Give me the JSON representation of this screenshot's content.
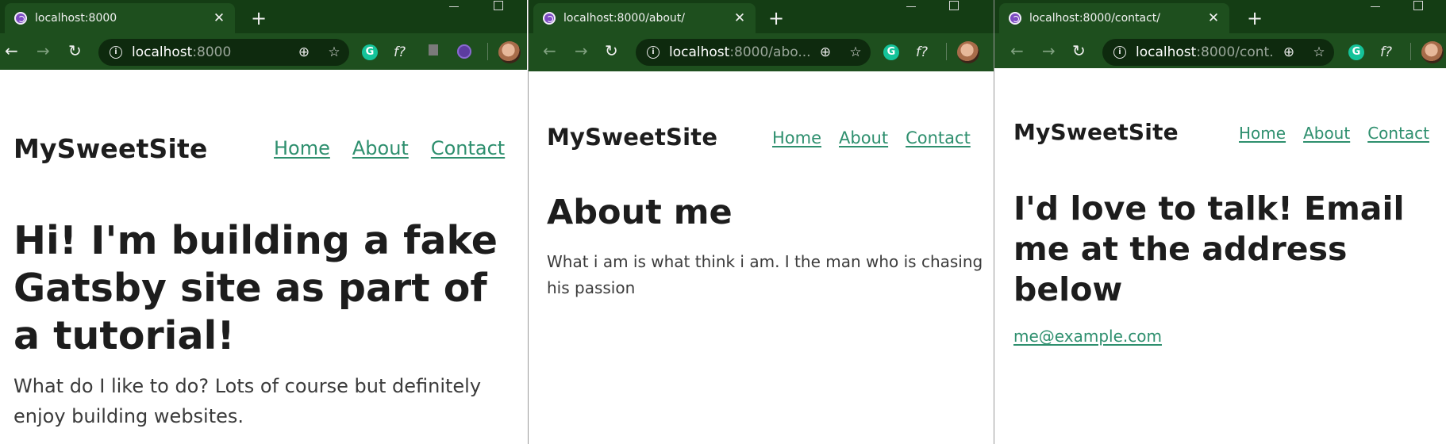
{
  "windows": [
    {
      "tab_title": "localhost:8000",
      "url_host": "localhost",
      "url_rest": ":8000",
      "site_title": "MySweetSite",
      "nav": [
        "Home",
        "About",
        "Contact"
      ],
      "heading": "Hi! I'm building a fake Gatsby site as part of a tutorial!",
      "paragraph": "What do I like to do? Lots of course but definitely enjoy building websites."
    },
    {
      "tab_title": "localhost:8000/about/",
      "url_host": "localhost",
      "url_rest": ":8000/abo...",
      "site_title": "MySweetSite",
      "nav": [
        "Home",
        "About",
        "Contact"
      ],
      "heading": "About me",
      "paragraph": "What i am is what think i am. I the man who is chasing his passion"
    },
    {
      "tab_title": "localhost:8000/contact/",
      "url_host": "localhost",
      "url_rest": ":8000/cont...",
      "site_title": "MySweetSite",
      "nav": [
        "Home",
        "About",
        "Contact"
      ],
      "heading": "I'd love to talk! Email me at the address below",
      "email": "me@example.com"
    }
  ],
  "extensions": {
    "grammarly_letter": "G",
    "formula_label": "f?"
  },
  "icons": {
    "back": "back-arrow-icon",
    "forward": "forward-arrow-icon",
    "reload": "reload-icon",
    "zoom": "zoom-icon",
    "bookmark": "star-icon",
    "close": "close-icon",
    "new_tab": "plus-icon"
  },
  "colors": {
    "chrome_bg": "#1e4f1e",
    "tabstrip_bg": "#143d14",
    "link": "#2e8f6e",
    "text": "#1d1d1d"
  }
}
